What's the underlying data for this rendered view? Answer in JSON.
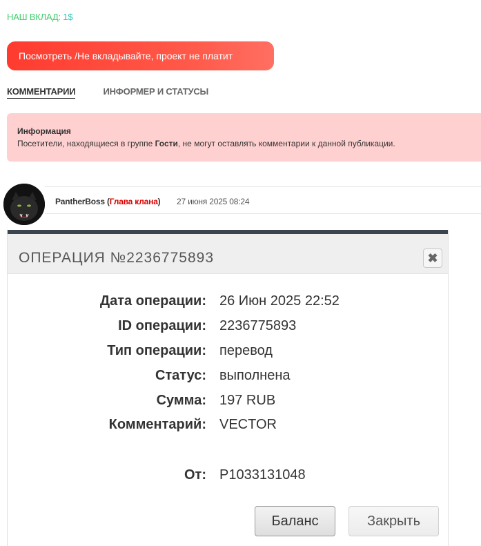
{
  "investment": {
    "label": "НАШ ВКЛАД:",
    "amount": "1$"
  },
  "cta_button": "Посмотреть /Не вкладывайте, проект не платит",
  "tabs": [
    {
      "label": "КОММЕНТАРИИ",
      "active": true
    },
    {
      "label": "ИНФОРМЕР И СТАТУСЫ",
      "active": false
    }
  ],
  "info_box": {
    "title": "Информация",
    "text_before": "Посетители, находящиеся в группе ",
    "group": "Гости",
    "text_after": ", не могут оставлять комментарии к данной публикации."
  },
  "comment": {
    "author": "PantherBoss",
    "role": "Глава клана",
    "date": "27 июня 2025 08:24"
  },
  "operation": {
    "title": "ОПЕРАЦИЯ №2236775893",
    "close_icon": "close-icon",
    "fields": [
      {
        "key": "Дата операции:",
        "value": "26 Июн 2025 22:52"
      },
      {
        "key": "ID операции:",
        "value": "2236775893"
      },
      {
        "key": "Тип операции:",
        "value": "перевод"
      },
      {
        "key": "Статус:",
        "value": "выполнена"
      },
      {
        "key": "Сумма:",
        "value": "197 RUB"
      },
      {
        "key": "Комментарий:",
        "value": "VECTOR"
      },
      {
        "key": "От:",
        "value": "P1033131048"
      }
    ],
    "balance_button": "Баланс",
    "close_button": "Закрыть"
  },
  "colors": {
    "cta": "#ff3b2f",
    "info_bg": "#ffd0d0",
    "role": "#dd0000"
  }
}
